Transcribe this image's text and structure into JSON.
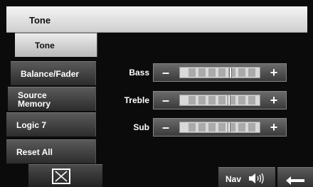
{
  "header": {
    "title": "Tone"
  },
  "sidebar": {
    "items": [
      {
        "label": "Tone",
        "active": true
      },
      {
        "label": "Balance/Fader",
        "active": false
      },
      {
        "label": "Source\nMemory",
        "active": false
      },
      {
        "label": "Logic 7",
        "active": false
      },
      {
        "label": "Reset All",
        "active": false
      }
    ]
  },
  "controls": [
    {
      "label": "Bass",
      "minus": "–",
      "plus": "+",
      "level": 0.62
    },
    {
      "label": "Treble",
      "minus": "–",
      "plus": "+",
      "level": 0.6
    },
    {
      "label": "Sub",
      "minus": "–",
      "plus": "+",
      "level": 0.6
    }
  ],
  "footer": {
    "nav_label": "Nav",
    "nav_icon": "speaker-icon",
    "back_icon": "return-arrow-icon",
    "close_icon": "close-x-icon"
  }
}
